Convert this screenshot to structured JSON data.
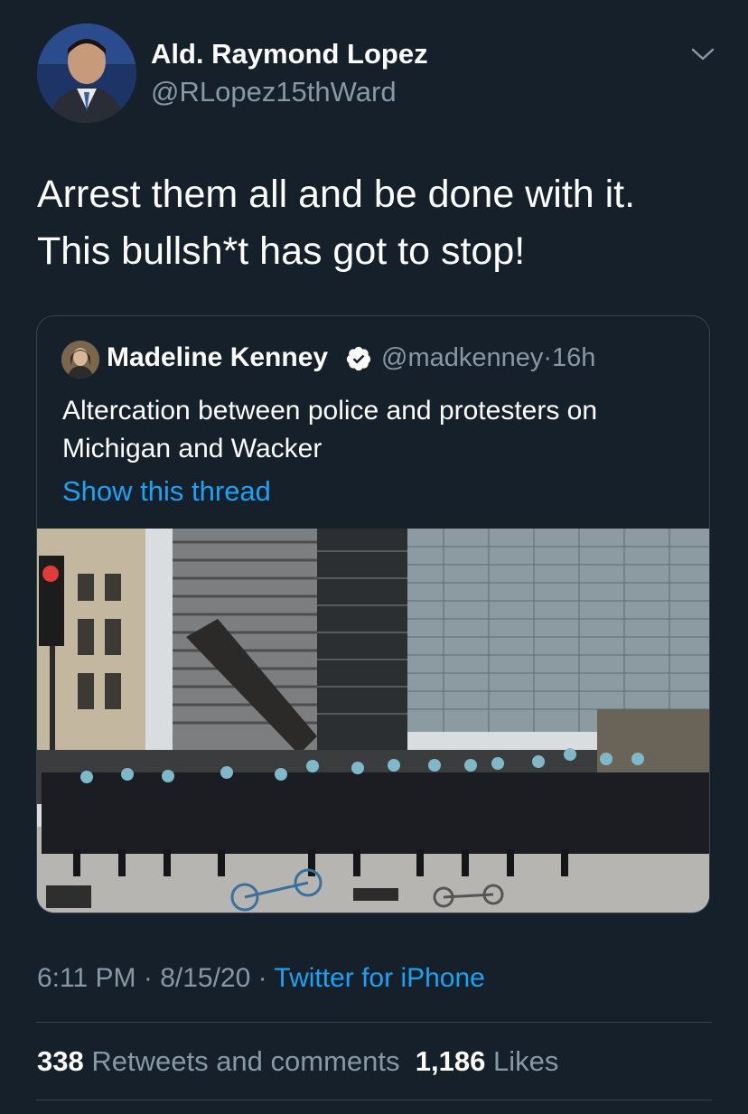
{
  "author": {
    "display_name": "Ald. Raymond Lopez",
    "handle": "@RLopez15thWard"
  },
  "tweet": {
    "lines": [
      "Arrest them all and be done with it.",
      "This bullsh*t has got to stop!"
    ]
  },
  "quoted_tweet": {
    "display_name": "Madeline Kenney",
    "handle": "@madkenney",
    "separator": "·",
    "time_ago": "16h",
    "lines": [
      "Altercation between police and protesters on",
      "Michigan and Wacker"
    ],
    "show_thread_label": "Show this thread"
  },
  "meta": {
    "time": "6:11 PM",
    "sep1": "·",
    "date": "8/15/20",
    "sep2": "·",
    "source": "Twitter for iPhone"
  },
  "stats": {
    "retweets_count": "338",
    "retweets_label": "Retweets and comments",
    "likes_count": "1,186",
    "likes_label": "Likes"
  },
  "colors": {
    "background": "#15202b",
    "accent": "#1da1f2",
    "secondary_text": "#8899a6",
    "border": "#38444d"
  },
  "icons": {
    "verified": "verified-badge-icon",
    "caret": "chevron-down-icon"
  }
}
